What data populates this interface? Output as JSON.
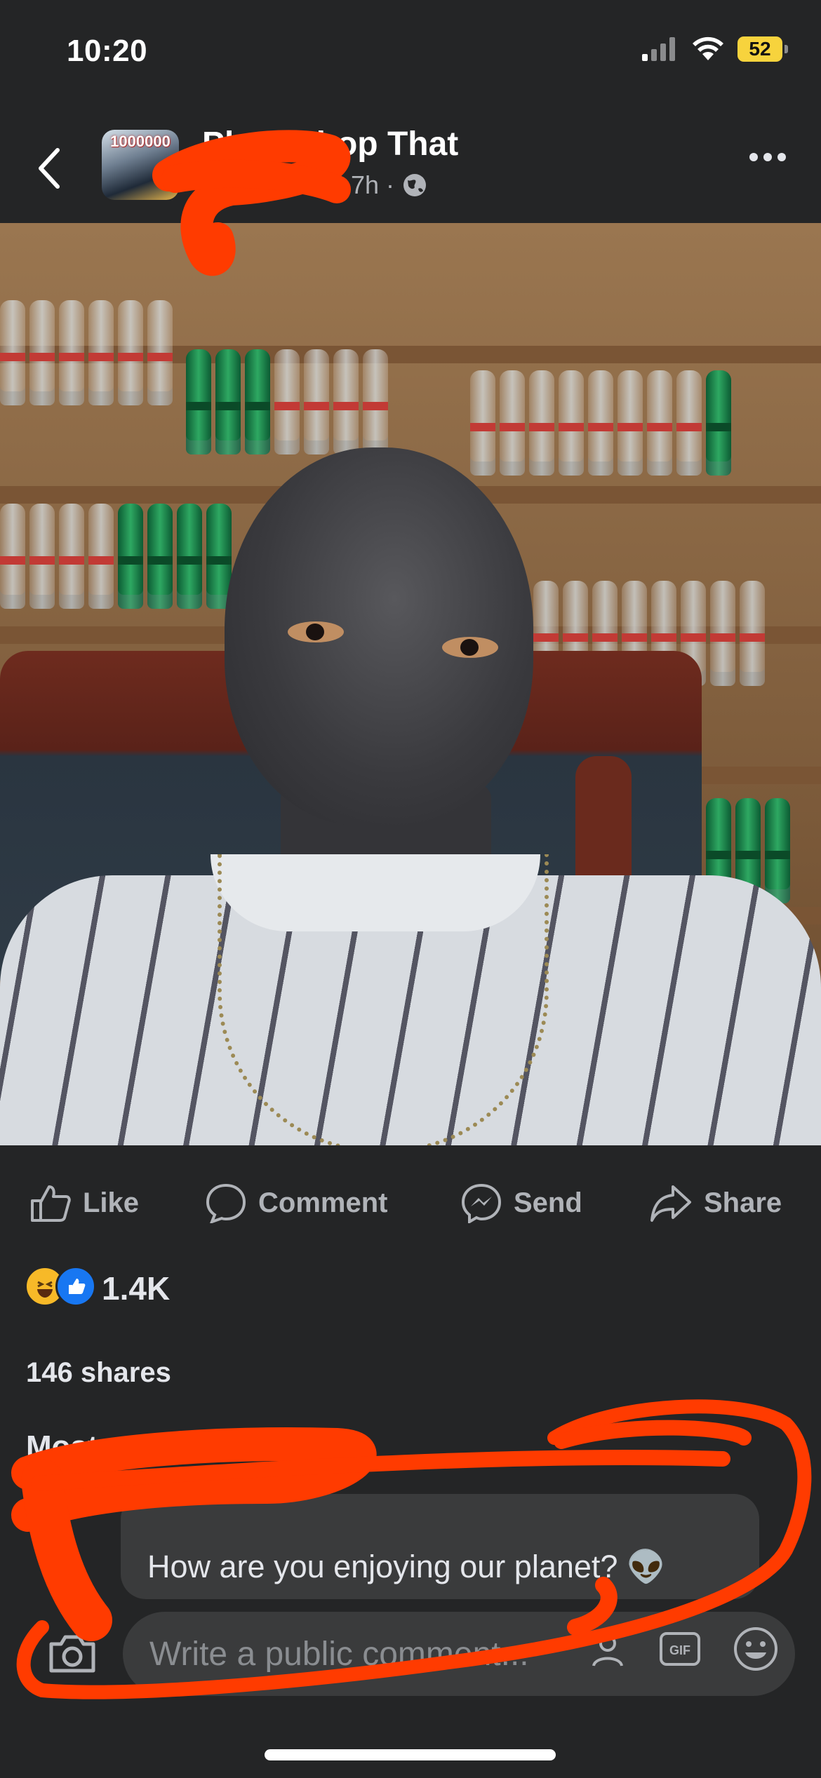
{
  "status_bar": {
    "time": "10:20",
    "battery": "52"
  },
  "post_header": {
    "avatar_text": "1000000",
    "page_name": "Photoshop That",
    "time_ago": "7h ·"
  },
  "actions": {
    "like": "Like",
    "comment": "Comment",
    "send": "Send",
    "share": "Share"
  },
  "reactions": {
    "count": "1.4K",
    "emojis": [
      "haha-icon",
      "like-icon"
    ]
  },
  "shares": "146 shares",
  "comments": {
    "sort_label": "Most relevant",
    "items": [
      {
        "author": "",
        "text": "How are you enjoying our planet? 👽"
      }
    ]
  },
  "composer": {
    "placeholder": "Write a public comment..."
  },
  "colors": {
    "background": "#242526",
    "bubble": "#3a3b3c",
    "scribble": "#ff3b00",
    "muted_text": "#b0b3b8"
  }
}
